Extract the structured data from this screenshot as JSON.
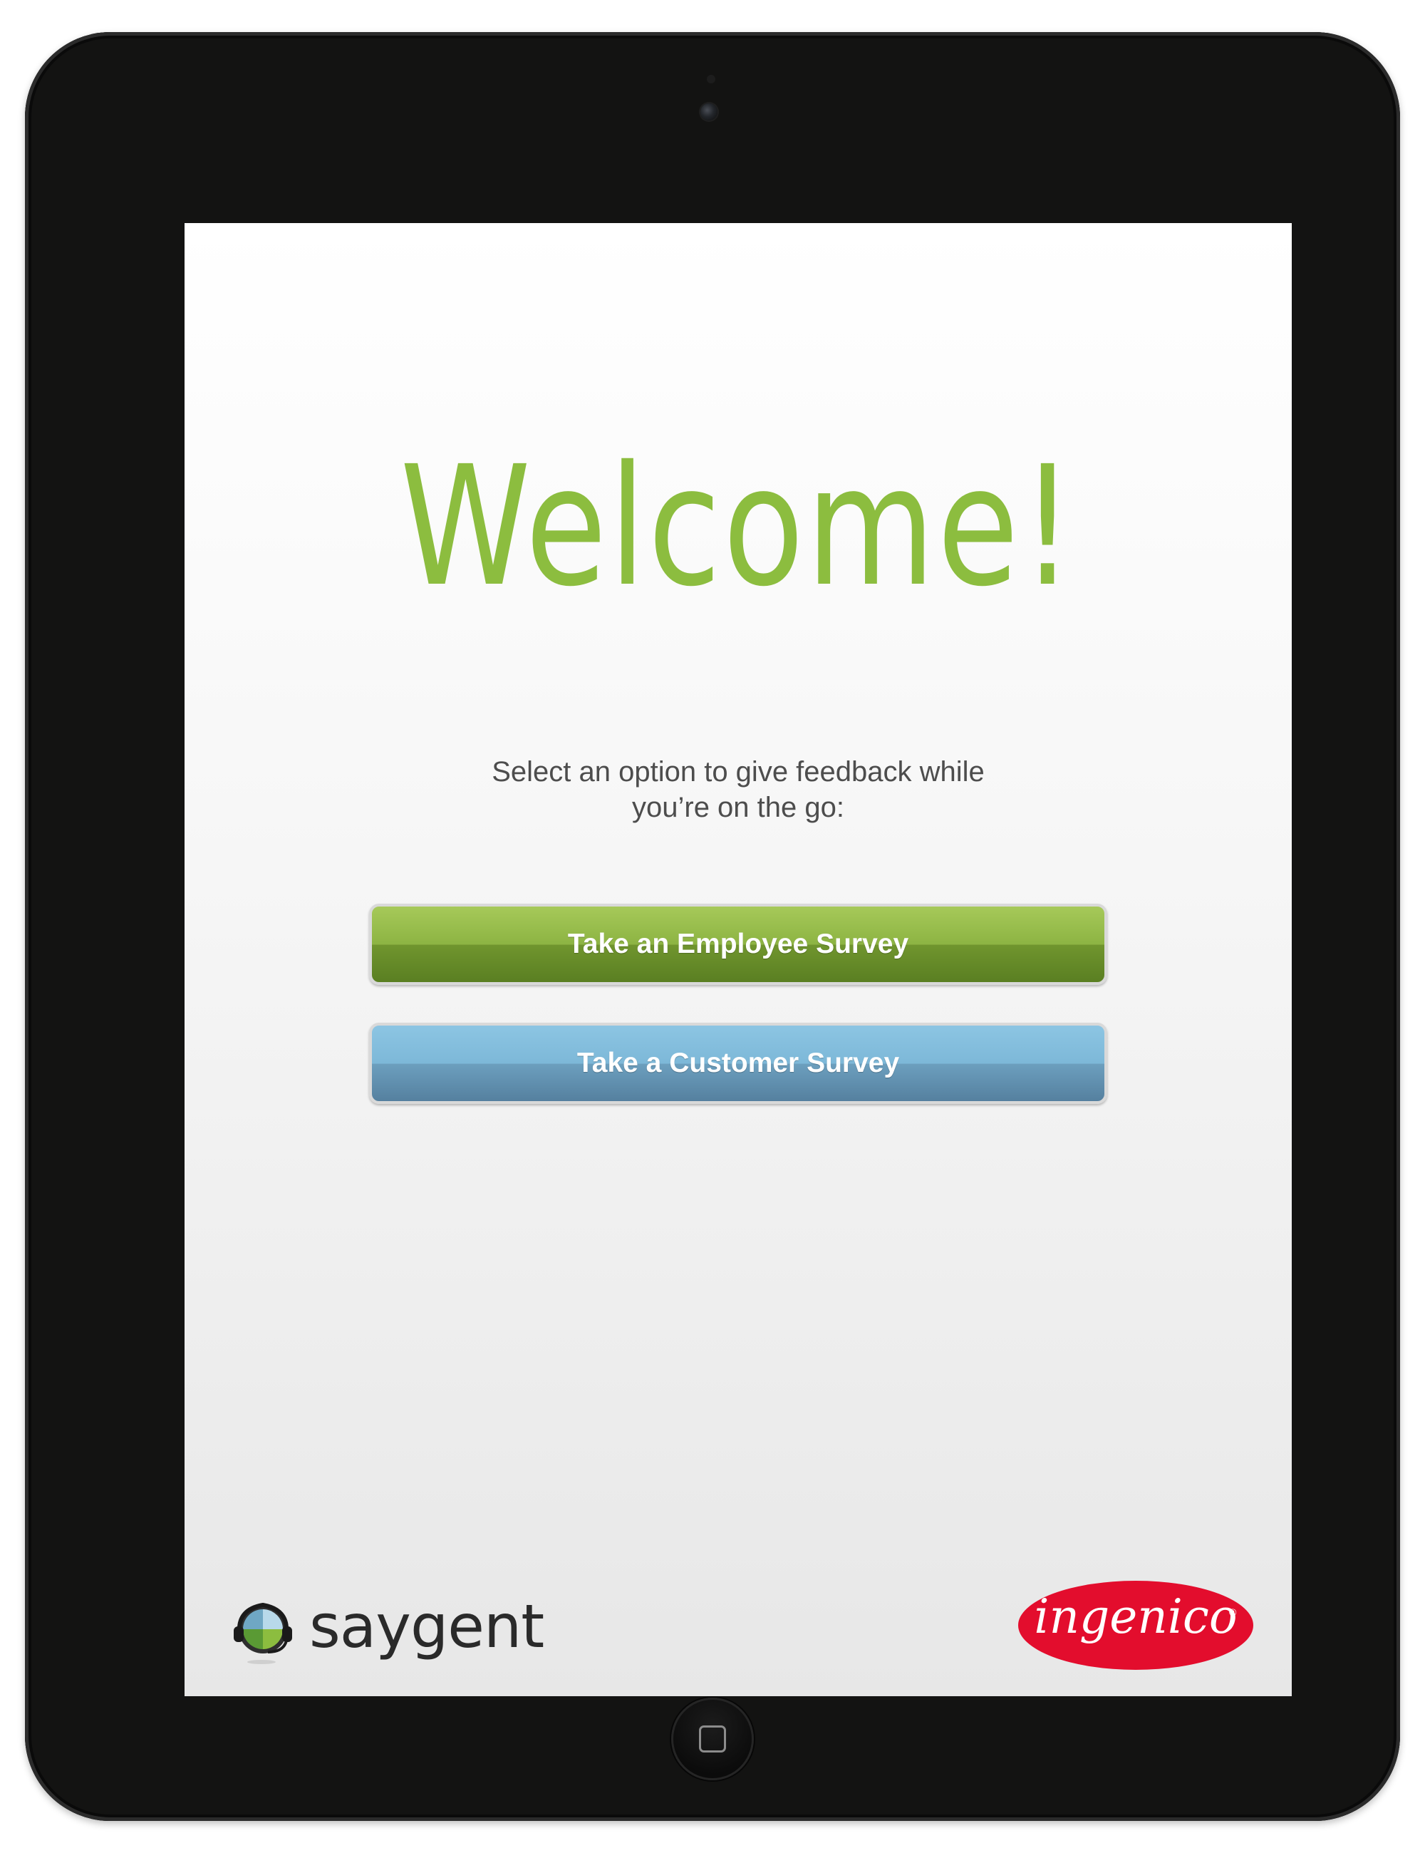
{
  "welcome": {
    "title": "Welcome!",
    "instructions_line1": "Select an option to give feedback while",
    "instructions_line2": "you’re on the go:"
  },
  "buttons": {
    "employee_label": "Take an Employee Survey",
    "customer_label": "Take a Customer Survey"
  },
  "branding": {
    "saygent": "saygent",
    "ingenico": "ingenico",
    "ingenico_reg": "®"
  },
  "colors": {
    "accent_green": "#8cbd3f",
    "employee_button": "#8db443",
    "customer_button": "#7db8d8",
    "ingenico_red": "#e30d2d",
    "device_body": "#131312"
  },
  "icons": {
    "saygent_logo": "saygent-headset-icon",
    "home_button": "home-button-icon",
    "camera": "camera-icon"
  }
}
